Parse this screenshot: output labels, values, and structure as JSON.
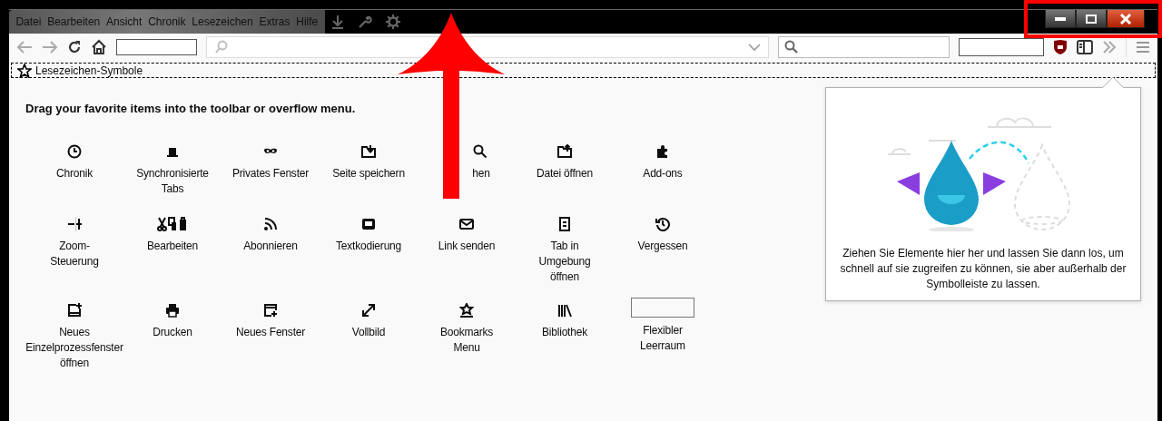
{
  "menu_bar": {
    "items": [
      {
        "label": "Datei"
      },
      {
        "label": "Bearbeiten"
      },
      {
        "label": "Ansicht"
      },
      {
        "label": "Chronik"
      },
      {
        "label": "Lesezeichen"
      },
      {
        "label": "Extras"
      },
      {
        "label": "Hilfe"
      }
    ]
  },
  "bookmarks_toolbar": {
    "label": "Lesezeichen-Symbole"
  },
  "palette": {
    "heading": "Drag your favorite items into the toolbar or overflow menu.",
    "items": [
      {
        "kind": "clock",
        "label": "Chronik"
      },
      {
        "kind": "sync",
        "label": "Synchronisierte Tabs"
      },
      {
        "kind": "private",
        "label": "Privates Fenster"
      },
      {
        "kind": "save",
        "label": "Seite speichern"
      },
      {
        "kind": "search",
        "label": "hen"
      },
      {
        "kind": "open",
        "label": "Datei öffnen"
      },
      {
        "kind": "addons",
        "label": "Add-ons"
      },
      {
        "kind": "zoom",
        "label": "Zoom-Steuerung"
      },
      {
        "kind": "edit",
        "label": "Bearbeiten"
      },
      {
        "kind": "feed",
        "label": "Abonnieren"
      },
      {
        "kind": "encoding",
        "label": "Textkodierung"
      },
      {
        "kind": "email",
        "label": "Link senden"
      },
      {
        "kind": "container",
        "label": "Tab in Umgebung öffnen"
      },
      {
        "kind": "forget",
        "label": "Vergessen"
      },
      {
        "kind": "newprocess",
        "label": "Neues Einzelprozessfenster öffnen"
      },
      {
        "kind": "print",
        "label": "Drucken"
      },
      {
        "kind": "newwindow",
        "label": "Neues Fenster"
      },
      {
        "kind": "fullscreen",
        "label": "Vollbild"
      },
      {
        "kind": "bookmarks",
        "label": "Bookmarks Menu"
      },
      {
        "kind": "library",
        "label": "Bibliothek"
      },
      {
        "kind": "spacer",
        "label": "Flexibler Leerraum"
      }
    ]
  },
  "overflow_panel": {
    "message": "Ziehen Sie Elemente hier her und lassen Sie dann los, um schnell auf sie zugreifen zu können, sie aber außerhalb der Symbolleiste zu lassen."
  }
}
